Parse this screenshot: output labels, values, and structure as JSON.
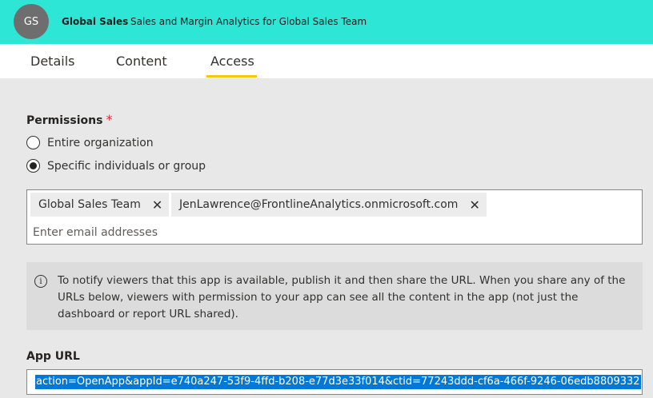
{
  "header": {
    "avatar_initials": "GS",
    "app_name": "Global Sales",
    "app_description": "Sales and Margin Analytics for Global Sales Team",
    "background_color": "#2de6d6"
  },
  "tabs": [
    {
      "label": "Details",
      "active": false
    },
    {
      "label": "Content",
      "active": false
    },
    {
      "label": "Access",
      "active": true
    }
  ],
  "permissions": {
    "label": "Permissions",
    "required_marker": "*",
    "options": [
      {
        "label": "Entire organization",
        "selected": false
      },
      {
        "label": "Specific individuals or group",
        "selected": true
      }
    ]
  },
  "recipients": {
    "chips": [
      {
        "label": "Global Sales Team"
      },
      {
        "label": "JenLawrence@FrontlineAnalytics.onmicrosoft.com"
      }
    ],
    "close_glyph": "✕",
    "placeholder": "Enter email addresses"
  },
  "info": {
    "icon": "info-icon",
    "text": "To notify viewers that this app is available, publish it and then share the URL. When you share any of the URLs below, viewers with permission to your app can see all the content in the app (not just the dashboard or report URL shared)."
  },
  "app_url": {
    "label": "App URL",
    "value": "action=OpenApp&appId=e740a247-53f9-4ffd-b208-e77d3e33f014&ctid=77243ddd-cf6a-466f-9246-06edb8809332"
  }
}
